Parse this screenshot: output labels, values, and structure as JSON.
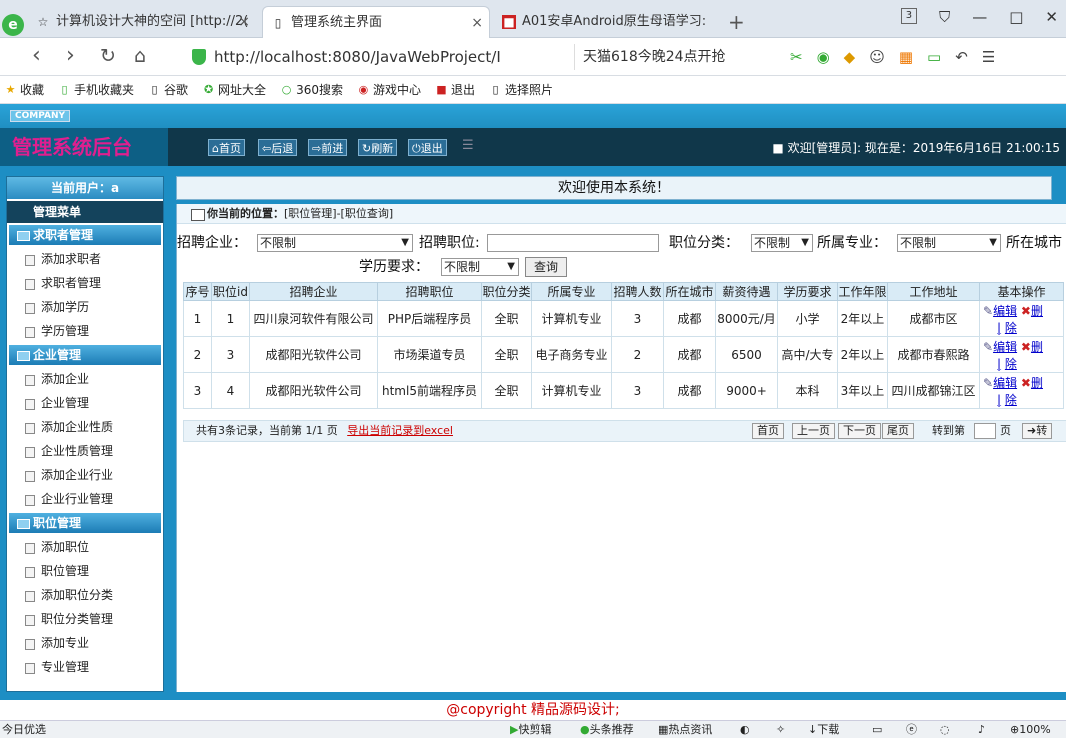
{
  "browser": {
    "tabs": [
      {
        "title": "计算机设计大神的空间 [http://2(",
        "icon": "star-icon"
      },
      {
        "title": "管理系统主界面",
        "icon": "page-icon"
      },
      {
        "title": "A01安卓Android原生母语学习:",
        "icon": "app-icon"
      }
    ],
    "new_tab": "+",
    "tab_count": "3",
    "address": "http://localhost:8080/JavaWebProject/I",
    "search_text": "天猫618今晚24点开抢",
    "bookmarks": [
      "收藏",
      "手机收藏夹",
      "谷歌",
      "网址大全",
      "360搜索",
      "游戏中心",
      "退出",
      "选择照片"
    ]
  },
  "app": {
    "company": "COMPANY",
    "brand": "管理系统后台",
    "toolbar": {
      "home": "首页",
      "back": "后退",
      "forward": "前进",
      "refresh": "刷新",
      "logout": "退出"
    },
    "welcome_user": "欢迎[管理员]:",
    "now_label": "现在是：2019年6月16日 21:00:15",
    "current_user": "当前用户：a",
    "menu_title": "管理菜单",
    "welcome_banner": "欢迎使用本系统！",
    "sections": [
      {
        "title": "求职者管理",
        "items": [
          "添加求职者",
          "求职者管理",
          "添加学历",
          "学历管理"
        ]
      },
      {
        "title": "企业管理",
        "items": [
          "添加企业",
          "企业管理",
          "添加企业性质",
          "企业性质管理",
          "添加企业行业",
          "企业行业管理"
        ]
      },
      {
        "title": "职位管理",
        "items": [
          "添加职位",
          "职位管理",
          "添加职位分类",
          "职位分类管理",
          "添加专业",
          "专业管理"
        ]
      }
    ]
  },
  "main": {
    "breadcrumb_label": "你当前的位置：",
    "breadcrumb_path": "[职位管理]-[职位查询]",
    "filters": {
      "company_label": "招聘企业：",
      "company_value": "不限制",
      "position_label": "招聘职位:",
      "category_label": "职位分类：",
      "category_value": "不限制",
      "major_label": "所属专业：",
      "major_value": "不限制",
      "city_label": "所在城市",
      "edu_label": "学历要求：",
      "edu_value": "不限制",
      "query_button": "查询"
    },
    "columns": [
      "序号",
      "职位id",
      "招聘企业",
      "招聘职位",
      "职位分类",
      "所属专业",
      "招聘人数",
      "所在城市",
      "薪资待遇",
      "学历要求",
      "工作年限",
      "工作地址",
      "基本操作"
    ],
    "rows": [
      [
        "1",
        "1",
        "四川泉河软件有限公司",
        "PHP后端程序员",
        "全职",
        "计算机专业",
        "3",
        "成都",
        "8000元/月",
        "小学",
        "2年以上",
        "成都市区"
      ],
      [
        "2",
        "3",
        "成都阳光软件公司",
        "市场渠道专员",
        "全职",
        "电子商务专业",
        "2",
        "成都",
        "6500",
        "高中/大专",
        "2年以上",
        "成都市春熙路"
      ],
      [
        "3",
        "4",
        "成都阳光软件公司",
        "html5前端程序员",
        "全职",
        "计算机专业",
        "3",
        "成都",
        "9000+",
        "本科",
        "3年以上",
        "四川成都锦江区"
      ]
    ],
    "actions": {
      "edit_a": "编辑",
      "edit_b": "|",
      "del_a": "删",
      "del_b": "除"
    },
    "pager": {
      "summary": "共有3条记录，当前第 1/1 页",
      "export": "导出当前记录到excel",
      "first": "首页",
      "prev": "上一页",
      "next": "下一页",
      "last": "尾页",
      "goto_label": "转到第",
      "page_unit": "页",
      "go": "转"
    }
  },
  "copyright": "@copyright 精品源码设计;",
  "status": {
    "left": "今日优选",
    "items": [
      "快剪辑",
      "头条推荐",
      "热点资讯",
      "下载",
      "100%"
    ]
  }
}
